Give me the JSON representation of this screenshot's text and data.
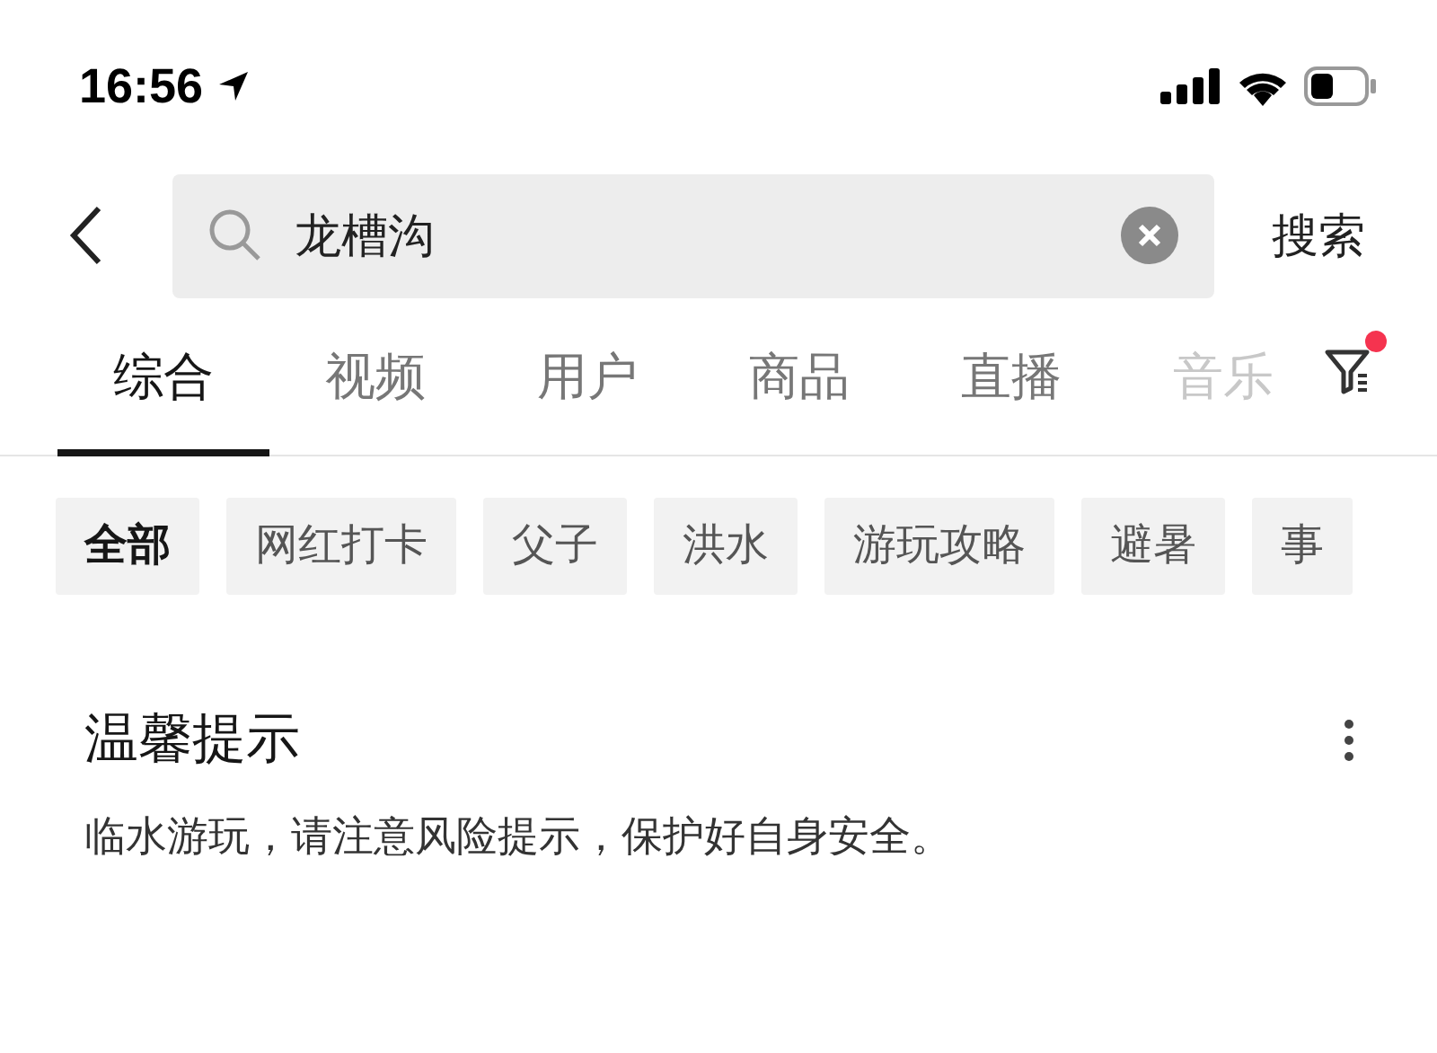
{
  "status_bar": {
    "time": "16:56"
  },
  "search": {
    "value": "龙槽沟",
    "button": "搜索"
  },
  "tabs": [
    {
      "label": "综合",
      "selected": true,
      "faded": false
    },
    {
      "label": "视频",
      "selected": false,
      "faded": false
    },
    {
      "label": "用户",
      "selected": false,
      "faded": false
    },
    {
      "label": "商品",
      "selected": false,
      "faded": false
    },
    {
      "label": "直播",
      "selected": false,
      "faded": false
    },
    {
      "label": "音乐",
      "selected": false,
      "faded": true
    }
  ],
  "filter": {
    "has_notice": true
  },
  "chips": [
    {
      "label": "全部",
      "selected": true
    },
    {
      "label": "网红打卡",
      "selected": false
    },
    {
      "label": "父子",
      "selected": false
    },
    {
      "label": "洪水",
      "selected": false
    },
    {
      "label": "游玩攻略",
      "selected": false
    },
    {
      "label": "避暑",
      "selected": false
    },
    {
      "label": "事",
      "selected": false
    }
  ],
  "notice": {
    "title": "温馨提示",
    "text": "临水游玩，请注意风险提示，保护好自身安全。"
  }
}
